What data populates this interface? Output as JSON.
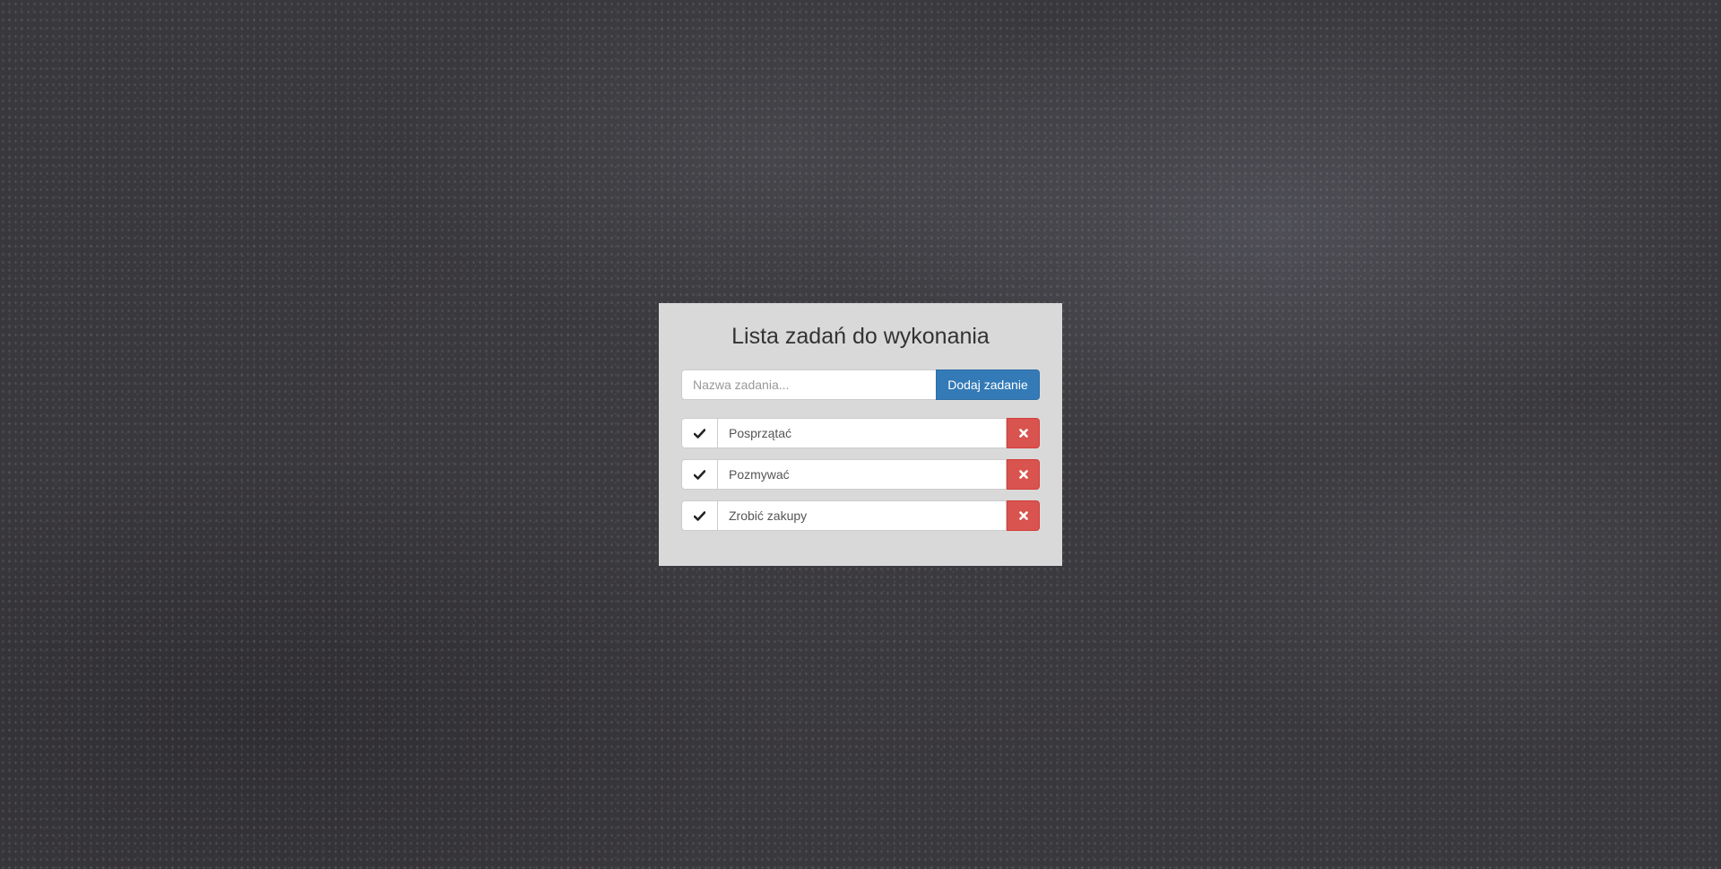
{
  "app": {
    "title": "Lista zadań do wykonania"
  },
  "add_form": {
    "placeholder": "Nazwa zadania...",
    "value": "",
    "button_label": "Dodaj zadanie"
  },
  "tasks": [
    {
      "label": "Posprzątać",
      "done_icon": "check-icon",
      "delete_icon": "close-icon"
    },
    {
      "label": "Pozmywać",
      "done_icon": "check-icon",
      "delete_icon": "close-icon"
    },
    {
      "label": "Zrobić zakupy",
      "done_icon": "check-icon",
      "delete_icon": "close-icon"
    }
  ],
  "colors": {
    "background": "#39383c",
    "panel": "#d9d9d9",
    "primary": "#337ab7",
    "danger": "#d9534f"
  }
}
